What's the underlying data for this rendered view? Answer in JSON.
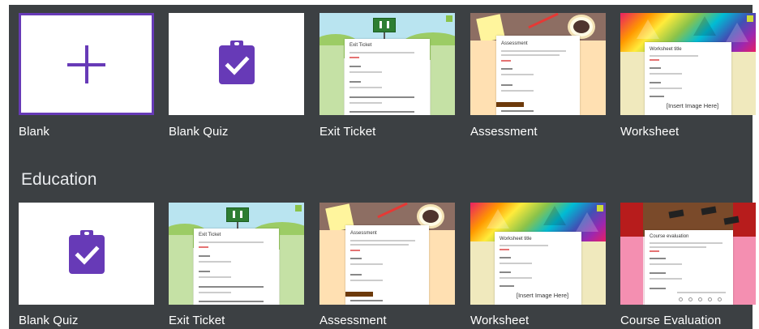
{
  "recent_templates": [
    {
      "label": "Blank"
    },
    {
      "label": "Blank Quiz"
    },
    {
      "label": "Exit Ticket",
      "preview_title": "Exit Ticket"
    },
    {
      "label": "Assessment",
      "preview_title": "Assessment"
    },
    {
      "label": "Worksheet",
      "preview_title": "Worksheet title",
      "image_placeholder": "[Insert Image Here]"
    }
  ],
  "education": {
    "title": "Education",
    "templates": [
      {
        "label": "Blank Quiz"
      },
      {
        "label": "Exit Ticket",
        "preview_title": "Exit Ticket"
      },
      {
        "label": "Assessment",
        "preview_title": "Assessment"
      },
      {
        "label": "Worksheet",
        "preview_title": "Worksheet title",
        "image_placeholder": "[Insert Image Here]"
      },
      {
        "label": "Course Evaluation",
        "preview_title": "Course evaluation"
      }
    ]
  },
  "colors": {
    "background": "#3c4043",
    "accent": "#673ab7"
  },
  "icons": [
    "plus-icon",
    "quiz-clipboard-check-icon"
  ]
}
